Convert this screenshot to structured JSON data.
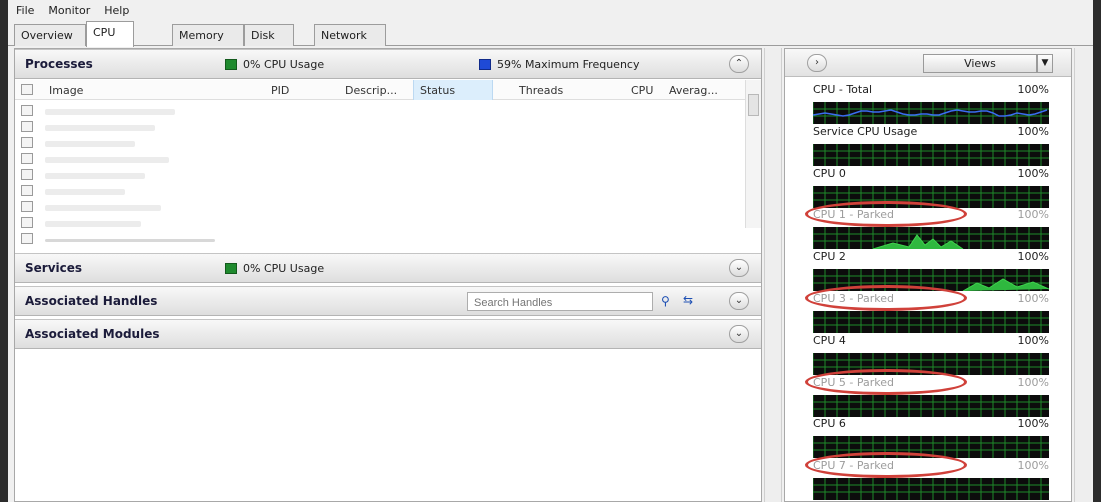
{
  "menu": [
    "File",
    "Monitor",
    "Help"
  ],
  "tabs": [
    "Overview",
    "CPU",
    "Memory",
    "Disk",
    "Network"
  ],
  "active_tab": "CPU",
  "processes": {
    "title": "Processes",
    "cpu_usage": "0% CPU Usage",
    "max_frequency": "59% Maximum Frequency",
    "columns": [
      "Image",
      "PID",
      "Descrip...",
      "Status",
      "Threads",
      "CPU",
      "Averag..."
    ]
  },
  "services": {
    "title": "Services",
    "cpu_usage": "0% CPU Usage"
  },
  "handles": {
    "title": "Associated Handles",
    "search_placeholder": "Search Handles"
  },
  "modules": {
    "title": "Associated Modules"
  },
  "right_panel": {
    "views_label": "Views",
    "cpus": [
      {
        "label": "CPU - Total",
        "percent": "100%",
        "parked": false
      },
      {
        "label": "Service CPU Usage",
        "percent": "100%",
        "parked": false
      },
      {
        "label": "CPU 0",
        "percent": "100%",
        "parked": false
      },
      {
        "label": "CPU 1 - Parked",
        "percent": "100%",
        "parked": true
      },
      {
        "label": "CPU 2",
        "percent": "100%",
        "parked": false
      },
      {
        "label": "CPU 3 - Parked",
        "percent": "100%",
        "parked": true
      },
      {
        "label": "CPU 4",
        "percent": "100%",
        "parked": false
      },
      {
        "label": "CPU 5 - Parked",
        "percent": "100%",
        "parked": true
      },
      {
        "label": "CPU 6",
        "percent": "100%",
        "parked": false
      },
      {
        "label": "CPU 7 - Parked",
        "percent": "100%",
        "parked": true
      }
    ]
  },
  "colors": {
    "graph_grid": "#1e8a2a",
    "total_line": "#3a6cf0",
    "cpu_usage_box": "#1f8a2e",
    "frequency_box": "#1f4ad6",
    "parked_highlight": "#d0413a"
  },
  "icons": [
    "expand-arrow-icon",
    "collapse-chevron-icon",
    "search-icon",
    "filter-icon"
  ]
}
